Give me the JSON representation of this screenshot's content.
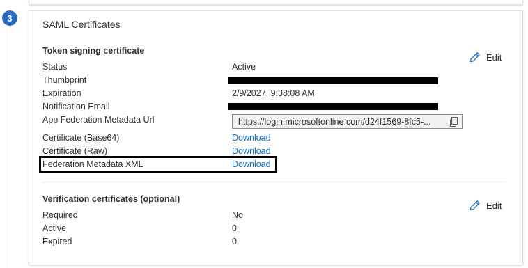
{
  "step": {
    "number": "3"
  },
  "saml": {
    "title": "SAML Certificates",
    "token": {
      "heading": "Token signing certificate",
      "edit_label": "Edit",
      "status_label": "Status",
      "status_value": "Active",
      "thumbprint_label": "Thumbprint",
      "expiration_label": "Expiration",
      "expiration_value": "2/9/2027, 9:38:08 AM",
      "notification_label": "Notification Email",
      "metadata_url_label": "App Federation Metadata Url",
      "metadata_url_value": "https://login.microsoftonline.com/d24f1569-8fc5-...",
      "cert_base64_label": "Certificate (Base64)",
      "cert_raw_label": "Certificate (Raw)",
      "fed_metadata_label": "Federation Metadata XML",
      "download_label": "Download"
    },
    "verification": {
      "heading": "Verification certificates (optional)",
      "edit_label": "Edit",
      "required_label": "Required",
      "required_value": "No",
      "active_label": "Active",
      "active_value": "0",
      "expired_label": "Expired",
      "expired_value": "0"
    }
  },
  "colors": {
    "link": "#0f6cbd",
    "badge": "#2b6bbf"
  },
  "icons": {
    "edit": "pencil-icon",
    "copy": "copy-icon"
  }
}
